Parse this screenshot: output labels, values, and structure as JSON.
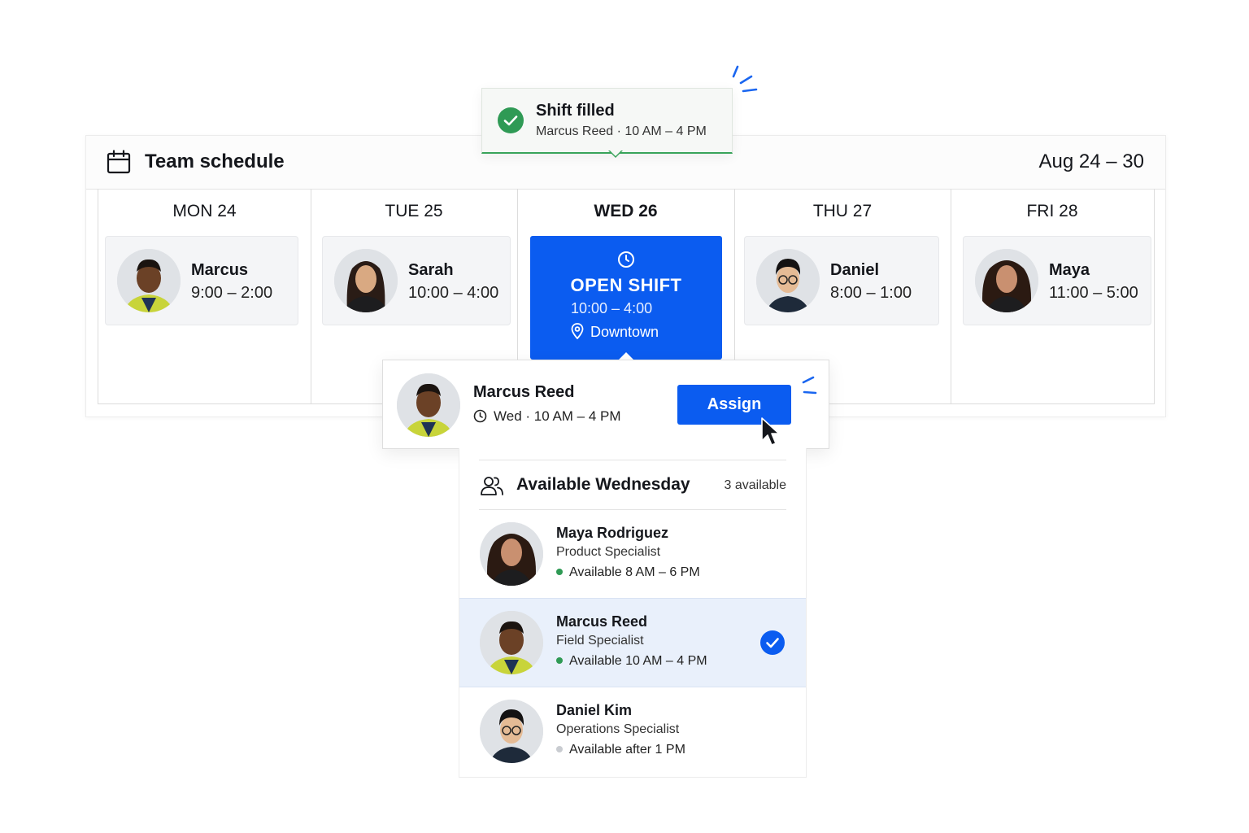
{
  "schedule": {
    "title": "Team schedule",
    "range": "Aug 24 – 30",
    "days": [
      {
        "label": "MON 24",
        "name": "Marcus",
        "time": "9:00 – 2:00"
      },
      {
        "label": "TUE 25",
        "name": "Sarah",
        "time": "10:00 – 4:00"
      },
      {
        "label": "WED 26"
      },
      {
        "label": "THU 27",
        "name": "Daniel",
        "time": "8:00 – 1:00"
      },
      {
        "label": "FRI 28",
        "name": "Maya",
        "time": "11:00 – 5:00"
      }
    ],
    "open_shift": {
      "title": "OPEN SHIFT",
      "time": "10:00 – 4:00",
      "location": "Downtown"
    }
  },
  "toast": {
    "title": "Shift filled",
    "subtitle": "Marcus Reed · 10 AM – 4 PM"
  },
  "assign": {
    "name": "Marcus Reed",
    "time": "Wed · 10 AM – 4 PM",
    "button": "Assign"
  },
  "available": {
    "title": "Available Wednesday",
    "count": "3 available",
    "people": [
      {
        "name": "Maya Rodriguez",
        "role": "Product Specialist",
        "availability": "Available 8 AM – 6 PM",
        "status_color": "#2f9a55",
        "selected": false
      },
      {
        "name": "Marcus Reed",
        "role": "Field Specialist",
        "availability": "Available 10 AM – 4 PM",
        "status_color": "#2f9a55",
        "selected": true
      },
      {
        "name": "Daniel Kim",
        "role": "Operations Specialist",
        "availability": "Available after 1 PM",
        "status_color": "#c9ccd1",
        "selected": false
      }
    ]
  },
  "colors": {
    "accent": "#0b5cf0",
    "success": "#2f9a55",
    "selected_row": "#e9f0fb"
  },
  "icons": [
    "calendar-icon",
    "clock-icon",
    "location-pin-icon",
    "check-icon",
    "people-icon",
    "cursor-icon"
  ]
}
